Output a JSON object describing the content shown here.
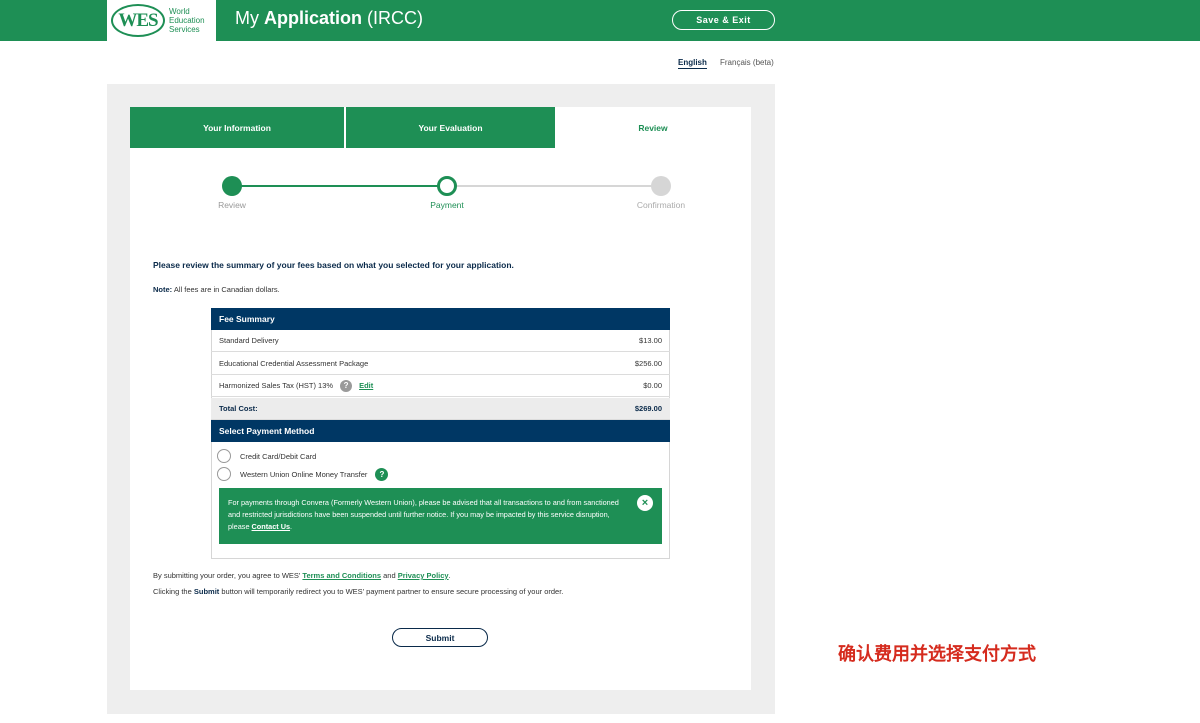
{
  "header": {
    "logo_mark": "WES",
    "logo_text": "World\nEducation\nServices",
    "title_prefix": "My ",
    "title_bold": "Application",
    "title_suffix": " (IRCC)",
    "save_exit_label": "Save & Exit"
  },
  "language": {
    "english": "English",
    "french": "Français (beta)",
    "selected": "English"
  },
  "tabs": [
    {
      "label": "Your Information",
      "state": "done"
    },
    {
      "label": "Your Evaluation",
      "state": "done"
    },
    {
      "label": "Review",
      "state": "current"
    }
  ],
  "steps": [
    {
      "label": "Review",
      "state": "complete"
    },
    {
      "label": "Payment",
      "state": "current"
    },
    {
      "label": "Confirmation",
      "state": "upcoming"
    }
  ],
  "intro": "Please review the summary of your fees based on what you selected for your application.",
  "note": {
    "label": "Note:",
    "text": " All fees are in Canadian dollars."
  },
  "fee_summary": {
    "title": "Fee Summary",
    "rows": [
      {
        "label": "Standard Delivery",
        "amount": "$13.00"
      },
      {
        "label": "Educational Credential Assessment Package",
        "amount": "$256.00"
      },
      {
        "label": "Harmonized Sales Tax (HST) 13%",
        "amount": "$0.00",
        "help": "?",
        "edit": "Edit"
      }
    ],
    "total_label": "Total Cost:",
    "total_amount": "$269.00"
  },
  "payment": {
    "title": "Select Payment Method",
    "options": [
      {
        "label": "Credit Card/Debit Card",
        "selected": false
      },
      {
        "label": "Western Union Online Money Transfer",
        "selected": false,
        "help": "?"
      }
    ],
    "notice": {
      "text": "For payments through Convera (Formerly Western Union), please be advised that all transactions to and from sanctioned and restricted jurisdictions have been suspended until further notice. If you may be impacted by this service disruption, please ",
      "link": "Contact Us",
      "end": ".",
      "close": "×"
    }
  },
  "agreement": {
    "pre": "By submitting your order, you agree to WES' ",
    "terms": "Terms and Conditions",
    "mid": " and ",
    "privacy": "Privacy Policy",
    "end": "."
  },
  "redirect": {
    "pre": "Clicking the ",
    "bold": "Submit",
    "post": " button will temporarily redirect you to WES' payment partner to ensure secure processing of your order."
  },
  "submit_label": "Submit",
  "caption": "确认费用并选择支付方式",
  "colors": {
    "brand_green": "#1e8f55",
    "navy": "#003764",
    "caption_red": "#d52b1e",
    "inactive_gray": "#d6d6d6"
  }
}
